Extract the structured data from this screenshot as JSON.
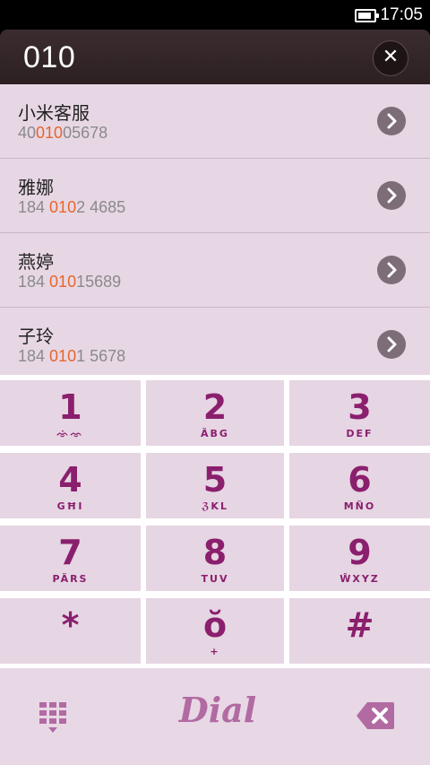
{
  "status_bar": {
    "time": "17:05",
    "battery_level": 0.9
  },
  "search": {
    "query": "010"
  },
  "results": [
    {
      "name": "小米客服",
      "number_pre": "40",
      "number_match": "010",
      "number_post": "05678"
    },
    {
      "name": "雅娜",
      "number_pre": "184 ",
      "number_match": "010",
      "number_post": "2 4685"
    },
    {
      "name": "燕婷",
      "number_pre": "184 ",
      "number_match": "010",
      "number_post": "15689"
    },
    {
      "name": "子玲",
      "number_pre": "184 ",
      "number_match": "010",
      "number_post": "1 5678"
    }
  ],
  "keypad": [
    {
      "digit": "1",
      "letters": "ᨎᨗᨎ"
    },
    {
      "digit": "2",
      "letters": "ÄBG"
    },
    {
      "digit": "3",
      "letters": "DEF"
    },
    {
      "digit": "4",
      "letters": "GĦI"
    },
    {
      "digit": "5",
      "letters": "ℨKL"
    },
    {
      "digit": "6",
      "letters": "MÑO"
    },
    {
      "digit": "7",
      "letters": "PÄRS"
    },
    {
      "digit": "8",
      "letters": "TUV"
    },
    {
      "digit": "9",
      "letters": "ŴXYZ"
    },
    {
      "digit": "*",
      "letters": ""
    },
    {
      "digit": "ŏ",
      "letters": "+"
    },
    {
      "digit": "#",
      "letters": ""
    }
  ],
  "bottom_bar": {
    "dial_label": "Dial"
  },
  "colors": {
    "accent": "#8a1f6d",
    "highlight": "#e8652a",
    "panel": "#e6d5e3"
  }
}
